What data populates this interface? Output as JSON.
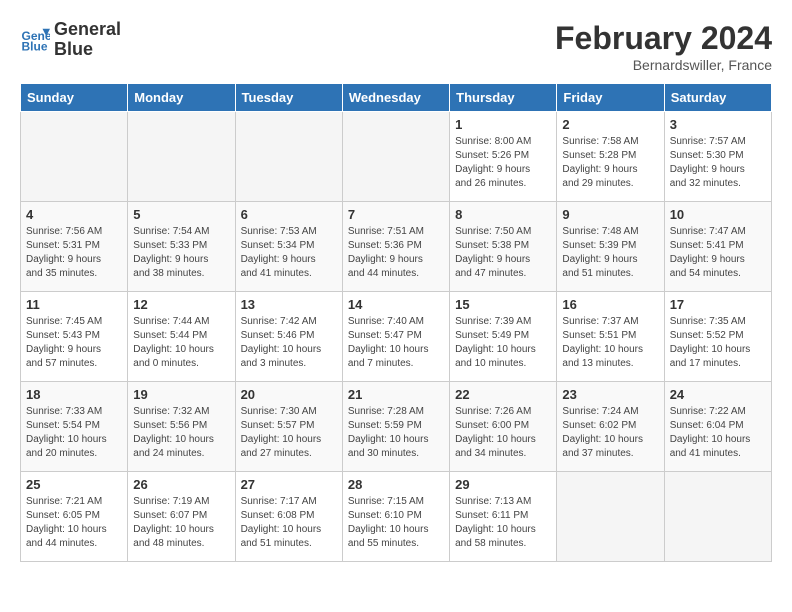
{
  "header": {
    "logo_line1": "General",
    "logo_line2": "Blue",
    "month_year": "February 2024",
    "location": "Bernardswiller, France"
  },
  "days_of_week": [
    "Sunday",
    "Monday",
    "Tuesday",
    "Wednesday",
    "Thursday",
    "Friday",
    "Saturday"
  ],
  "weeks": [
    [
      {
        "day": "",
        "info": ""
      },
      {
        "day": "",
        "info": ""
      },
      {
        "day": "",
        "info": ""
      },
      {
        "day": "",
        "info": ""
      },
      {
        "day": "1",
        "info": "Sunrise: 8:00 AM\nSunset: 5:26 PM\nDaylight: 9 hours\nand 26 minutes."
      },
      {
        "day": "2",
        "info": "Sunrise: 7:58 AM\nSunset: 5:28 PM\nDaylight: 9 hours\nand 29 minutes."
      },
      {
        "day": "3",
        "info": "Sunrise: 7:57 AM\nSunset: 5:30 PM\nDaylight: 9 hours\nand 32 minutes."
      }
    ],
    [
      {
        "day": "4",
        "info": "Sunrise: 7:56 AM\nSunset: 5:31 PM\nDaylight: 9 hours\nand 35 minutes."
      },
      {
        "day": "5",
        "info": "Sunrise: 7:54 AM\nSunset: 5:33 PM\nDaylight: 9 hours\nand 38 minutes."
      },
      {
        "day": "6",
        "info": "Sunrise: 7:53 AM\nSunset: 5:34 PM\nDaylight: 9 hours\nand 41 minutes."
      },
      {
        "day": "7",
        "info": "Sunrise: 7:51 AM\nSunset: 5:36 PM\nDaylight: 9 hours\nand 44 minutes."
      },
      {
        "day": "8",
        "info": "Sunrise: 7:50 AM\nSunset: 5:38 PM\nDaylight: 9 hours\nand 47 minutes."
      },
      {
        "day": "9",
        "info": "Sunrise: 7:48 AM\nSunset: 5:39 PM\nDaylight: 9 hours\nand 51 minutes."
      },
      {
        "day": "10",
        "info": "Sunrise: 7:47 AM\nSunset: 5:41 PM\nDaylight: 9 hours\nand 54 minutes."
      }
    ],
    [
      {
        "day": "11",
        "info": "Sunrise: 7:45 AM\nSunset: 5:43 PM\nDaylight: 9 hours\nand 57 minutes."
      },
      {
        "day": "12",
        "info": "Sunrise: 7:44 AM\nSunset: 5:44 PM\nDaylight: 10 hours\nand 0 minutes."
      },
      {
        "day": "13",
        "info": "Sunrise: 7:42 AM\nSunset: 5:46 PM\nDaylight: 10 hours\nand 3 minutes."
      },
      {
        "day": "14",
        "info": "Sunrise: 7:40 AM\nSunset: 5:47 PM\nDaylight: 10 hours\nand 7 minutes."
      },
      {
        "day": "15",
        "info": "Sunrise: 7:39 AM\nSunset: 5:49 PM\nDaylight: 10 hours\nand 10 minutes."
      },
      {
        "day": "16",
        "info": "Sunrise: 7:37 AM\nSunset: 5:51 PM\nDaylight: 10 hours\nand 13 minutes."
      },
      {
        "day": "17",
        "info": "Sunrise: 7:35 AM\nSunset: 5:52 PM\nDaylight: 10 hours\nand 17 minutes."
      }
    ],
    [
      {
        "day": "18",
        "info": "Sunrise: 7:33 AM\nSunset: 5:54 PM\nDaylight: 10 hours\nand 20 minutes."
      },
      {
        "day": "19",
        "info": "Sunrise: 7:32 AM\nSunset: 5:56 PM\nDaylight: 10 hours\nand 24 minutes."
      },
      {
        "day": "20",
        "info": "Sunrise: 7:30 AM\nSunset: 5:57 PM\nDaylight: 10 hours\nand 27 minutes."
      },
      {
        "day": "21",
        "info": "Sunrise: 7:28 AM\nSunset: 5:59 PM\nDaylight: 10 hours\nand 30 minutes."
      },
      {
        "day": "22",
        "info": "Sunrise: 7:26 AM\nSunset: 6:00 PM\nDaylight: 10 hours\nand 34 minutes."
      },
      {
        "day": "23",
        "info": "Sunrise: 7:24 AM\nSunset: 6:02 PM\nDaylight: 10 hours\nand 37 minutes."
      },
      {
        "day": "24",
        "info": "Sunrise: 7:22 AM\nSunset: 6:04 PM\nDaylight: 10 hours\nand 41 minutes."
      }
    ],
    [
      {
        "day": "25",
        "info": "Sunrise: 7:21 AM\nSunset: 6:05 PM\nDaylight: 10 hours\nand 44 minutes."
      },
      {
        "day": "26",
        "info": "Sunrise: 7:19 AM\nSunset: 6:07 PM\nDaylight: 10 hours\nand 48 minutes."
      },
      {
        "day": "27",
        "info": "Sunrise: 7:17 AM\nSunset: 6:08 PM\nDaylight: 10 hours\nand 51 minutes."
      },
      {
        "day": "28",
        "info": "Sunrise: 7:15 AM\nSunset: 6:10 PM\nDaylight: 10 hours\nand 55 minutes."
      },
      {
        "day": "29",
        "info": "Sunrise: 7:13 AM\nSunset: 6:11 PM\nDaylight: 10 hours\nand 58 minutes."
      },
      {
        "day": "",
        "info": ""
      },
      {
        "day": "",
        "info": ""
      }
    ]
  ]
}
